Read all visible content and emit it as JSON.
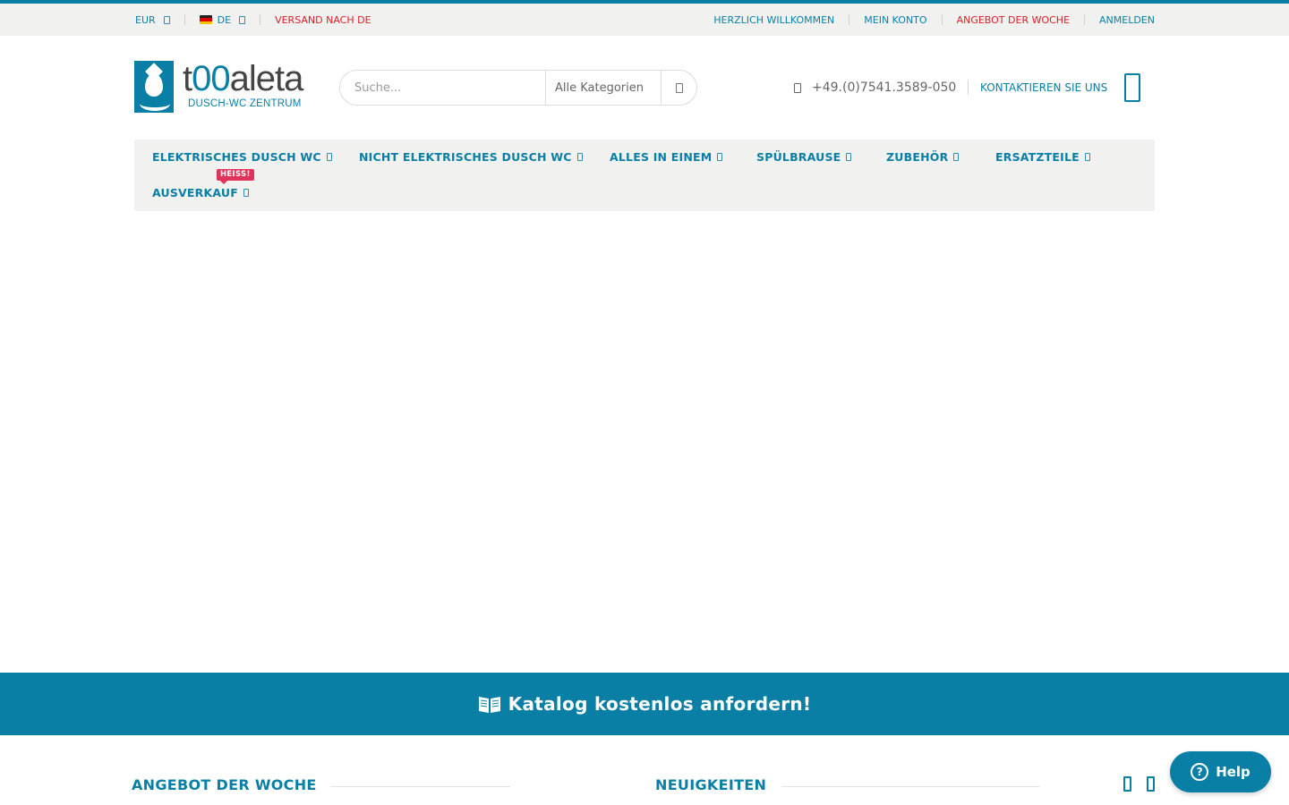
{
  "colors": {
    "accent": "#0a7fa6",
    "alert": "#d9202a",
    "hot_badge": "#e0335a",
    "bar_bg": "#f1f1ef"
  },
  "topbar": {
    "currency": "EUR",
    "language": "DE",
    "shipping": "VERSAND NACH DE",
    "welcome": "HERZLICH WILLKOMMEN",
    "account": "MEIN KONTO",
    "deal": "ANGEBOT DER WOCHE",
    "login": "ANMELDEN"
  },
  "logo": {
    "word_prefix": "t",
    "word_oo": "00",
    "word_suffix": "aleta",
    "tagline": "DUSCH-WC ZENTRUM"
  },
  "search": {
    "placeholder": "Suche...",
    "category": "Alle Kategorien",
    "icon": "search-icon"
  },
  "header": {
    "phone": "+49.(0)7541.3589-050",
    "phone_icon": "phone-icon",
    "contact": "KONTAKTIEREN SIE UNS",
    "cart_icon": "cart-icon"
  },
  "menu": {
    "items": [
      "ELEKTRISCHES DUSCH WC",
      "NICHT ELEKTRISCHES DUSCH WC",
      "ALLES IN EINEM",
      "SPÜLBRAUSE",
      "ZUBEHÖR",
      "ERSATZTEILE",
      "AUSVERKAUF"
    ],
    "hot_badge": "HEISS!"
  },
  "banner": {
    "text": "Katalog kostenlos anfordern!",
    "icon": "book-icon"
  },
  "sections": {
    "deal_title": "ANGEBOT DER WOCHE",
    "news_title": "NEUIGKEITEN"
  },
  "help": {
    "label": "Help",
    "icon_glyph": "?"
  }
}
